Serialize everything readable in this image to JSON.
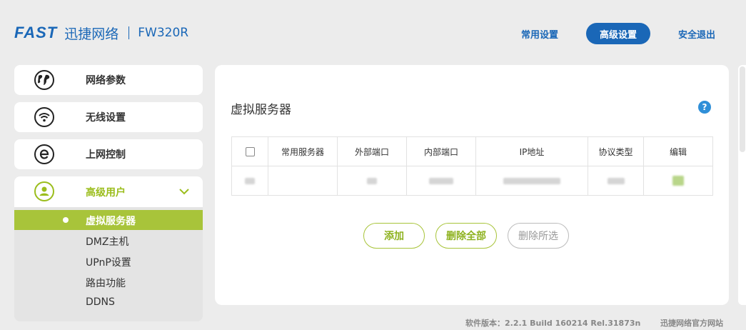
{
  "header": {
    "logo_brand": "FAST",
    "logo_cn": "迅捷网络",
    "model": "FW320R",
    "nav": [
      {
        "label": "常用设置",
        "active": false
      },
      {
        "label": "高级设置",
        "active": true
      },
      {
        "label": "安全退出",
        "active": false
      }
    ]
  },
  "sidebar": {
    "items": [
      {
        "label": "网络参数",
        "icon": "globe-icon"
      },
      {
        "label": "无线设置",
        "icon": "wifi-icon"
      },
      {
        "label": "上网控制",
        "icon": "internet-e-icon"
      },
      {
        "label": "高级用户",
        "icon": "user-icon",
        "expanded": true
      }
    ],
    "submenu": [
      {
        "label": "虚拟服务器",
        "active": true
      },
      {
        "label": "DMZ主机"
      },
      {
        "label": "UPnP设置"
      },
      {
        "label": "路由功能"
      },
      {
        "label": "DDNS"
      }
    ]
  },
  "main": {
    "title": "虚拟服务器",
    "help": "?",
    "table": {
      "headers": [
        "",
        "常用服务器",
        "外部端口",
        "内部端口",
        "IP地址",
        "协议类型",
        "编辑"
      ],
      "rows_note_blurred": true
    },
    "buttons": {
      "add": "添加",
      "delete_all": "删除全部",
      "delete_selected": "删除所选"
    }
  },
  "footer": {
    "version": "软件版本：2.2.1 Build 160214 Rel.31873n",
    "official_site": "迅捷网络官方网站"
  },
  "colors": {
    "brand_blue": "#1a67b7",
    "accent_green": "#a8c43a",
    "help_blue": "#2f8fd8"
  }
}
